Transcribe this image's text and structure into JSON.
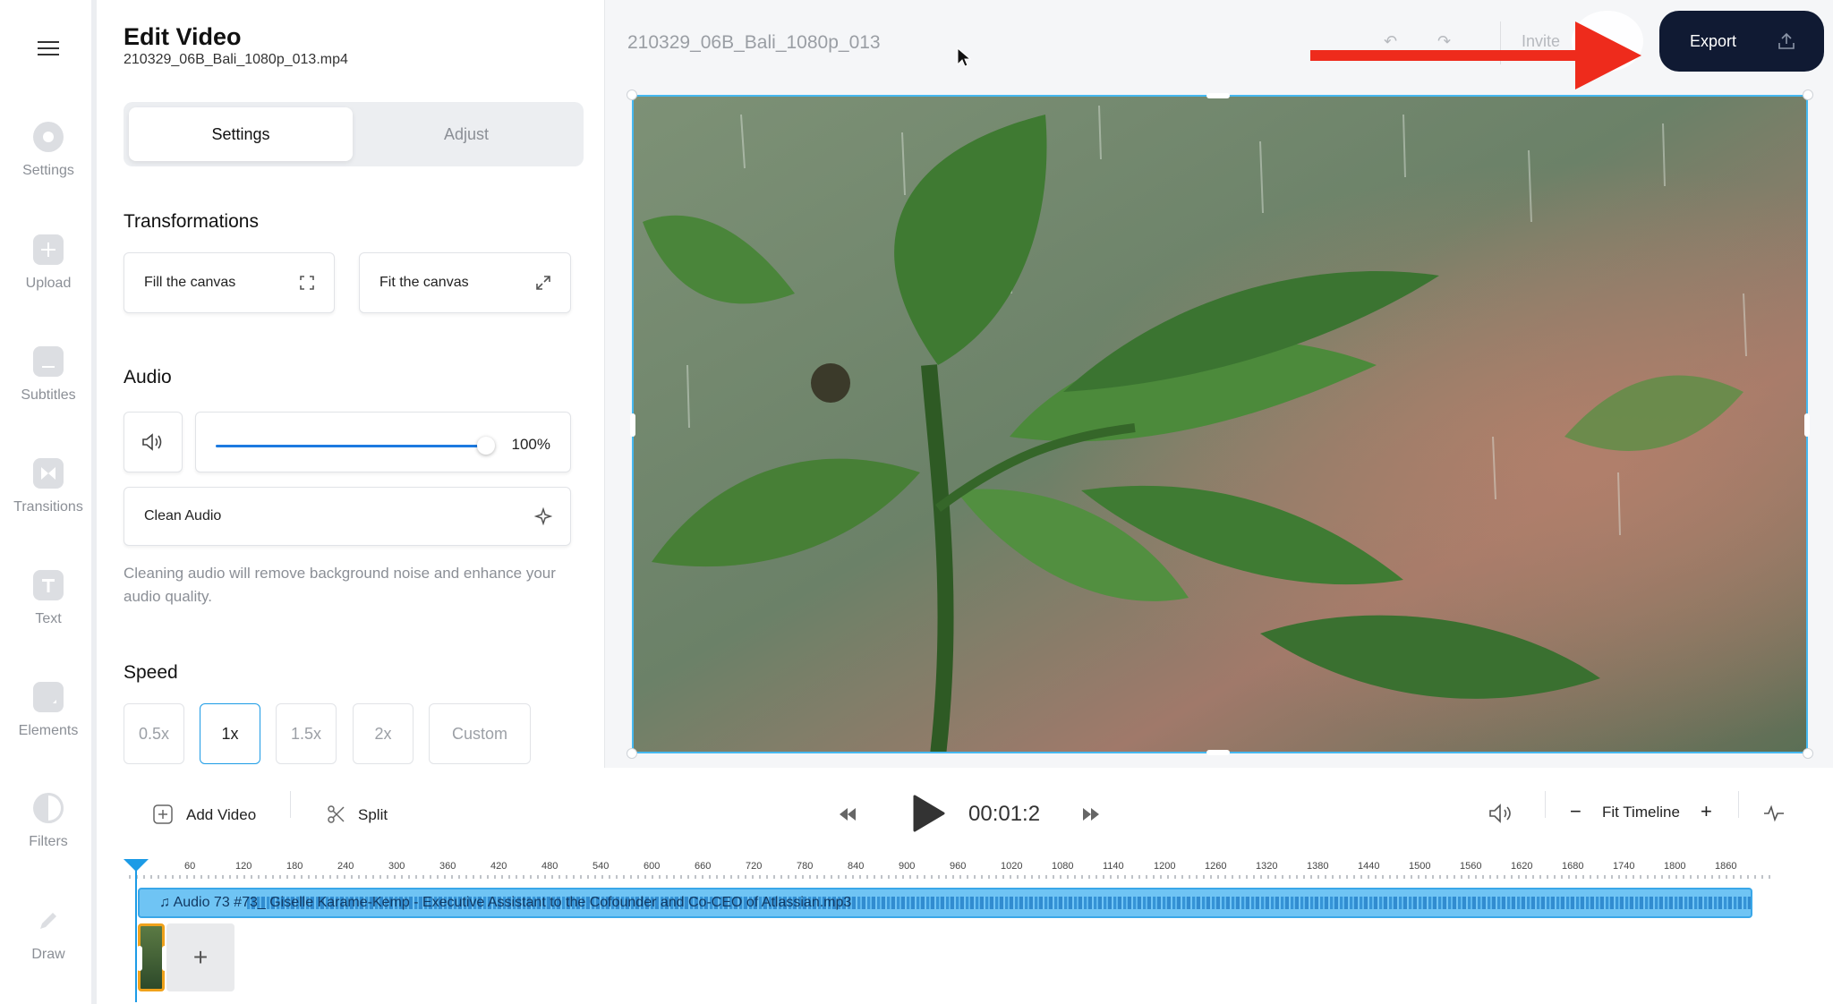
{
  "rail": {
    "items": [
      {
        "label": "Settings",
        "icon": "gear-icon"
      },
      {
        "label": "Upload",
        "icon": "plus-icon"
      },
      {
        "label": "Subtitles",
        "icon": "subtitles-icon"
      },
      {
        "label": "Transitions",
        "icon": "transitions-icon"
      },
      {
        "label": "Text",
        "icon": "text-icon"
      },
      {
        "label": "Elements",
        "icon": "elements-icon"
      },
      {
        "label": "Filters",
        "icon": "filters-icon"
      },
      {
        "label": "Draw",
        "icon": "pencil-icon"
      }
    ]
  },
  "panel": {
    "title": "Edit Video",
    "filename": "210329_06B_Bali_1080p_013.mp4",
    "tabs": [
      "Settings",
      "Adjust"
    ],
    "transformations": {
      "heading": "Transformations",
      "fill": "Fill the canvas",
      "fit": "Fit the canvas"
    },
    "audio": {
      "heading": "Audio",
      "volume": "100%",
      "volume_level": 1.0,
      "clean": "Clean Audio",
      "note": "Cleaning audio will remove background noise and enhance your audio quality."
    },
    "speed": {
      "heading": "Speed",
      "options": [
        "0.5x",
        "1x",
        "1.5x",
        "2x",
        "Custom"
      ],
      "selected": "1x"
    }
  },
  "topbar": {
    "project_name": "210329_06B_Bali_1080p_013",
    "invite": "Invite",
    "export": "Export"
  },
  "controls": {
    "add_video": "Add Video",
    "split": "Split",
    "time": "00:01:2",
    "fit_timeline": "Fit Timeline"
  },
  "timeline": {
    "ruler": [
      "60",
      "120",
      "180",
      "240",
      "300",
      "360",
      "420",
      "480",
      "540",
      "600",
      "660",
      "720",
      "780",
      "840",
      "900",
      "960",
      "1020",
      "1080",
      "1140",
      "1200",
      "1260",
      "1320",
      "1380",
      "1440",
      "1500",
      "1560",
      "1620",
      "1680",
      "1740",
      "1800",
      "1860"
    ],
    "audio_track": "Audio 73 #73_ Giselle Karame-Kemp - Executive Assistant to the Cofounder and Co-CEO of Atlassian.mp3",
    "add_clip": "+"
  },
  "colors": {
    "accent": "#1c9be6",
    "export_bg": "#101a33",
    "arrow": "#ee2b1c",
    "clip_border": "#f0a21b"
  }
}
